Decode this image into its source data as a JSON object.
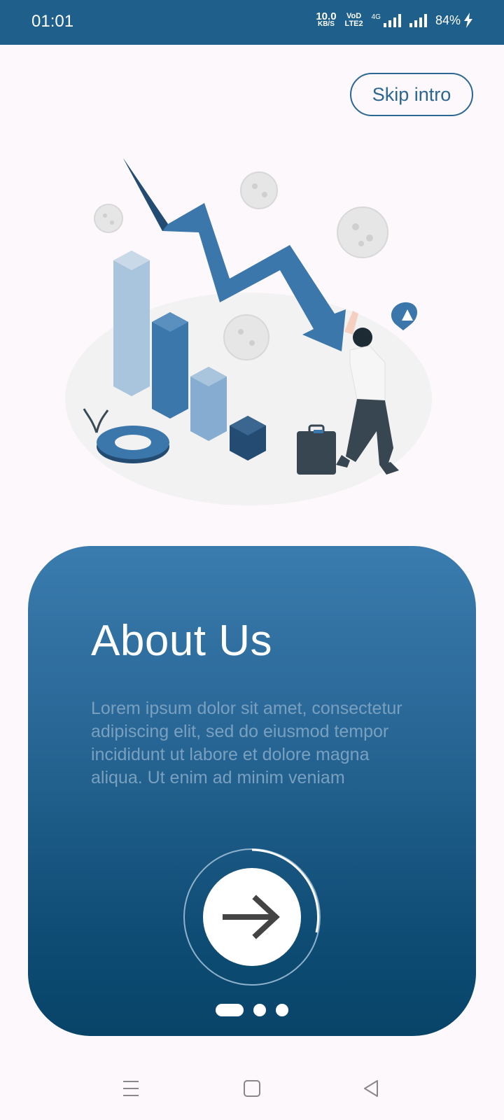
{
  "status_bar": {
    "time": "01:01",
    "net_speed_value": "10.0",
    "net_speed_unit": "KB/S",
    "volte_top": "VoD",
    "volte_bottom": "LTE2",
    "network_type": "4G",
    "battery": "84%",
    "icons": [
      "net-speed-icon",
      "volte-icon",
      "signal-4g-icon",
      "signal-icon",
      "battery-charging-icon"
    ]
  },
  "header": {
    "skip_label": "Skip intro"
  },
  "illustration": {
    "name": "falling-chart-illustration"
  },
  "card": {
    "title": "About Us",
    "body": "Lorem ipsum dolor sit amet, consectetur adipiscing elit, sed do eiusmod tempor incididunt ut labore et dolore magna aliqua. Ut enim ad minim veniam",
    "next_icon": "arrow-right-icon",
    "page_index": 1,
    "page_count": 3,
    "progress_fraction": 0.33
  },
  "nav_bar": {
    "icons": [
      "menu-icon",
      "home-square-icon",
      "back-triangle-icon"
    ]
  },
  "colors": {
    "primary": "#1f5f8b",
    "accent_outline": "#2b6792",
    "card_top": "#3a7cae",
    "card_bottom": "#084468",
    "body_text": "#7aa0bf",
    "background": "#fdf8fc"
  }
}
